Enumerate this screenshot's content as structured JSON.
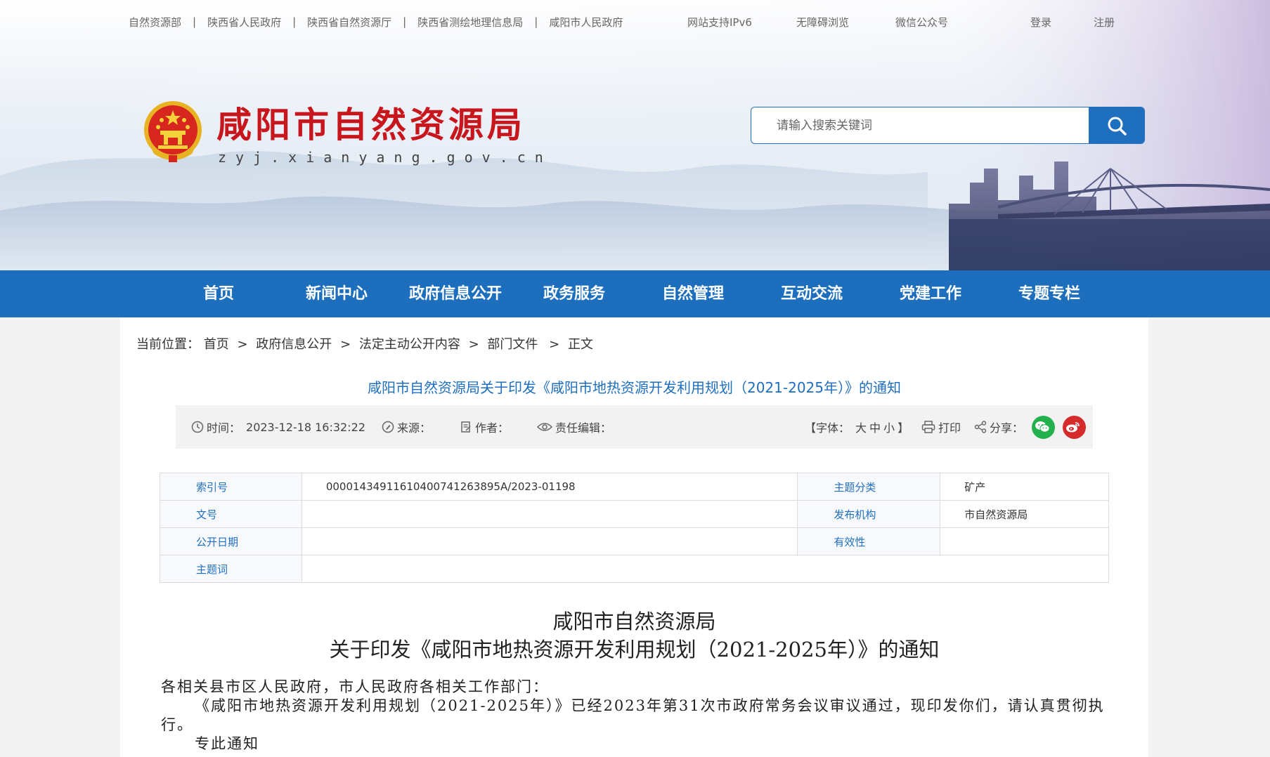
{
  "top_links": [
    "自然资源部",
    "陕西省人民政府",
    "陕西省自然资源厅",
    "陕西省测绘地理信息局",
    "咸阳市人民政府"
  ],
  "top_links_sep": "|",
  "top_right": {
    "ipv6": "网站支持IPv6",
    "accessible": "无障碍浏览",
    "wechat": "微信公众号",
    "login": "登录",
    "register": "注册"
  },
  "site": {
    "title": "咸阳市自然资源局",
    "url": "zyj.xianyang.gov.cn"
  },
  "search": {
    "placeholder": "请输入搜索关键词"
  },
  "nav": [
    "首页",
    "新闻中心",
    "政府信息公开",
    "政务服务",
    "自然管理",
    "互动交流",
    "党建工作",
    "专题专栏"
  ],
  "breadcrumb": {
    "label": "当前位置：",
    "items": [
      "首页",
      "政府信息公开",
      "法定主动公开内容",
      "部门文件",
      "正文"
    ],
    "sep": ">"
  },
  "article": {
    "title": "咸阳市自然资源局关于印发《咸阳市地热资源开发利用规划（2021-2025年）》的通知",
    "meta": {
      "time_label": "时间：",
      "time_value": "2023-12-18 16:32:22",
      "source_label": "来源：",
      "author_label": "作者：",
      "editor_label": "责任编辑：",
      "font_label": "【字体：",
      "font_sizes": [
        "大",
        "中",
        "小"
      ],
      "font_end": "】",
      "print": "打印",
      "share": "分享："
    }
  },
  "info_table": {
    "rows": [
      {
        "k1": "索引号",
        "v1": "00001434911610400741263895A/2023-01198",
        "k2": "主题分类",
        "v2": "矿产"
      },
      {
        "k1": "文号",
        "v1": "",
        "k2": "发布机构",
        "v2": "市自然资源局"
      },
      {
        "k1": "公开日期",
        "v1": "",
        "k2": "有效性",
        "v2": ""
      },
      {
        "k1": "主题词",
        "v1": ""
      }
    ]
  },
  "body": {
    "title_line1": "咸阳市自然资源局",
    "title_line2": "关于印发《咸阳市地热资源开发利用规划（2021-2025年）》的通知",
    "salutation": "各相关县市区人民政府，市人民政府各相关工作部门：",
    "para1_line1": "《咸阳市地热资源开发利用规划（2021-2025年）》已经2023年第31次市政府常务会议审议通过，现印发你们，请认真贯彻执",
    "para1_line2": "行。",
    "closing": "专此通知"
  },
  "colors": {
    "brand_red": "#c8161d",
    "nav_blue": "#1d6fbe",
    "link_blue": "#1f6fbf",
    "wechat_green": "#22b14c",
    "weibo_red": "#d52b2b"
  },
  "icons": [
    "search-icon",
    "clock-icon",
    "pen-icon",
    "document-icon",
    "eye-icon",
    "printer-icon",
    "share-icon",
    "wechat-icon",
    "weibo-icon",
    "national-emblem"
  ]
}
